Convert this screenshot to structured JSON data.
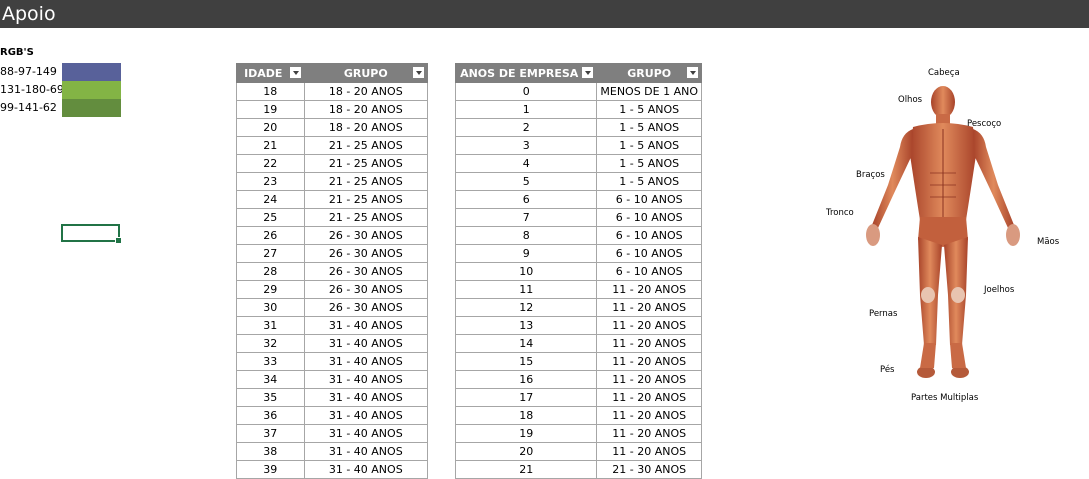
{
  "sheet": {
    "title": "Apoio"
  },
  "rgb": {
    "title": "RGB'S",
    "items": [
      {
        "label": "88-97-149",
        "color": "#58619a"
      },
      {
        "label": "131-180-69",
        "color": "#83b445"
      },
      {
        "label": "99-141-62",
        "color": "#638d3e"
      }
    ]
  },
  "idade_table": {
    "headers": [
      "IDADE",
      "GRUPO"
    ],
    "rows": [
      [
        "18",
        "18 - 20 ANOS"
      ],
      [
        "19",
        "18 - 20 ANOS"
      ],
      [
        "20",
        "18 - 20 ANOS"
      ],
      [
        "21",
        "21 - 25 ANOS"
      ],
      [
        "22",
        "21 - 25 ANOS"
      ],
      [
        "23",
        "21 - 25 ANOS"
      ],
      [
        "24",
        "21 - 25 ANOS"
      ],
      [
        "25",
        "21 - 25 ANOS"
      ],
      [
        "26",
        "26 - 30 ANOS"
      ],
      [
        "27",
        "26 - 30 ANOS"
      ],
      [
        "28",
        "26 - 30 ANOS"
      ],
      [
        "29",
        "26 - 30 ANOS"
      ],
      [
        "30",
        "26 - 30 ANOS"
      ],
      [
        "31",
        "31 - 40 ANOS"
      ],
      [
        "32",
        "31 - 40 ANOS"
      ],
      [
        "33",
        "31 - 40 ANOS"
      ],
      [
        "34",
        "31 - 40 ANOS"
      ],
      [
        "35",
        "31 - 40 ANOS"
      ],
      [
        "36",
        "31 - 40 ANOS"
      ],
      [
        "37",
        "31 - 40 ANOS"
      ],
      [
        "38",
        "31 - 40 ANOS"
      ],
      [
        "39",
        "31 - 40 ANOS"
      ]
    ]
  },
  "empresa_table": {
    "headers": [
      "ANOS DE EMPRESA",
      "GRUPO"
    ],
    "rows": [
      [
        "0",
        "MENOS DE 1 ANO"
      ],
      [
        "1",
        "1 - 5 ANOS"
      ],
      [
        "2",
        "1 - 5 ANOS"
      ],
      [
        "3",
        "1 - 5 ANOS"
      ],
      [
        "4",
        "1 - 5 ANOS"
      ],
      [
        "5",
        "1 - 5 ANOS"
      ],
      [
        "6",
        "6 - 10 ANOS"
      ],
      [
        "7",
        "6 - 10 ANOS"
      ],
      [
        "8",
        "6 - 10 ANOS"
      ],
      [
        "9",
        "6 - 10 ANOS"
      ],
      [
        "10",
        "6 - 10 ANOS"
      ],
      [
        "11",
        "11 - 20 ANOS"
      ],
      [
        "12",
        "11 - 20 ANOS"
      ],
      [
        "13",
        "11 - 20 ANOS"
      ],
      [
        "14",
        "11 - 20 ANOS"
      ],
      [
        "15",
        "11 - 20 ANOS"
      ],
      [
        "16",
        "11 - 20 ANOS"
      ],
      [
        "17",
        "11 - 20 ANOS"
      ],
      [
        "18",
        "11 - 20 ANOS"
      ],
      [
        "19",
        "11 - 20 ANOS"
      ],
      [
        "20",
        "11 - 20 ANOS"
      ],
      [
        "21",
        "21 - 30 ANOS"
      ]
    ]
  },
  "body_labels": {
    "cabeca": "Cabeça",
    "olhos": "Olhos",
    "pescoco": "Pescoço",
    "bracos": "Braços",
    "tronco": "Tronco",
    "maos": "Mãos",
    "joelhos": "Joelhos",
    "pernas": "Pernas",
    "pes": "Pés",
    "partes_multiplas": "Partes Multiplas"
  },
  "icons": {
    "dropdown": "filter-dropdown-icon",
    "body_image": "human-muscle-anatomy-image"
  }
}
